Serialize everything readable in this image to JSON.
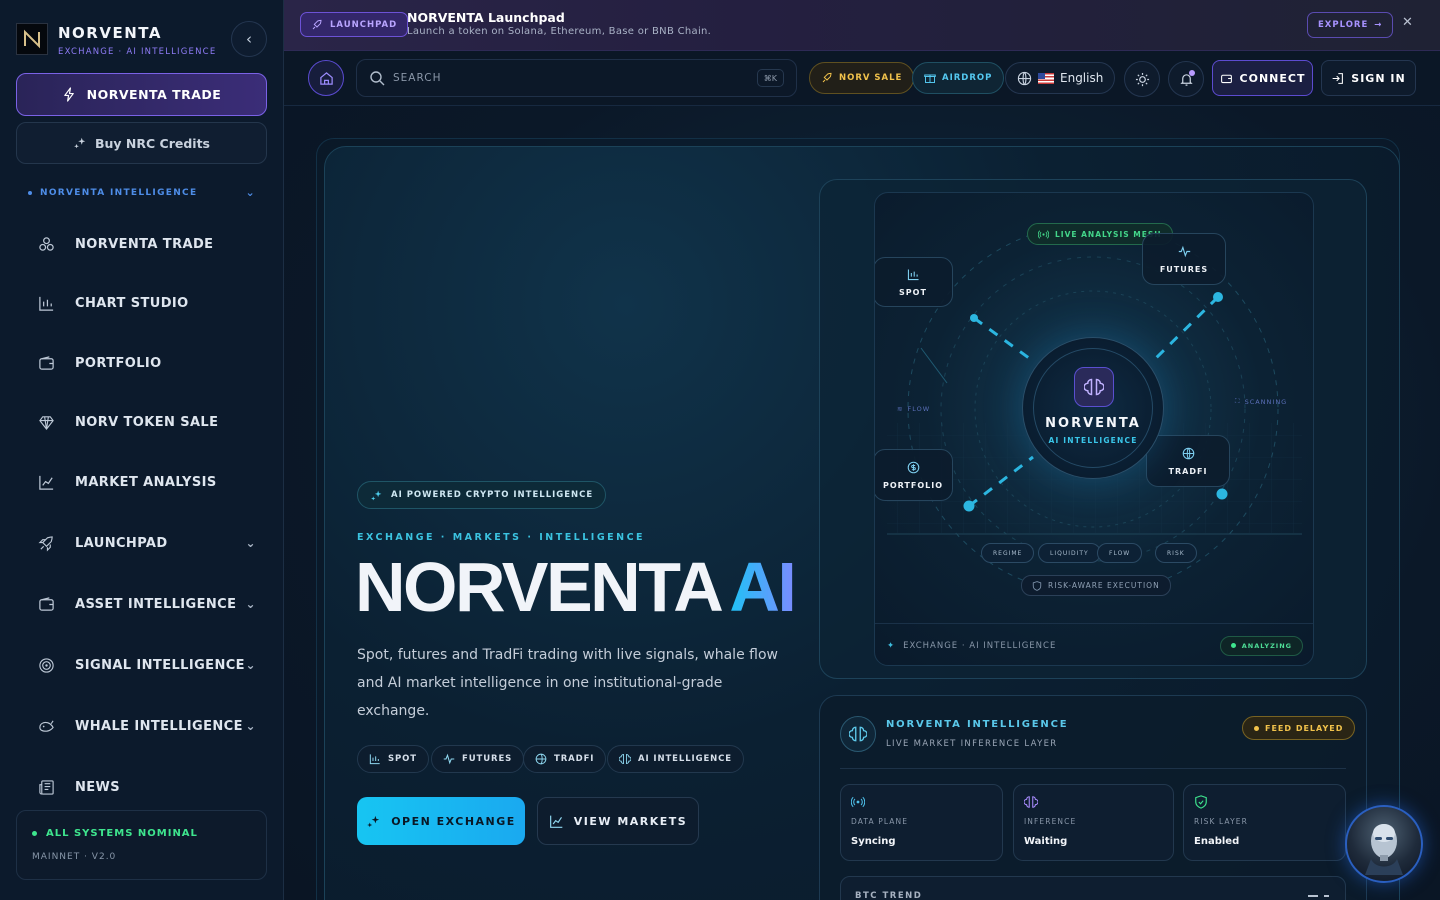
{
  "sidebar": {
    "brand": "NORVENTA",
    "brand_sub": "EXCHANGE · AI INTELLIGENCE",
    "primary_button": "NORVENTA TRADE",
    "credits_button": "Buy NRC Credits",
    "section_title": "NORVENTA INTELLIGENCE",
    "items": [
      {
        "label": "NORVENTA TRADE",
        "icon": "trade-nodes-icon",
        "expandable": false
      },
      {
        "label": "CHART STUDIO",
        "icon": "chart-studio-icon",
        "expandable": false
      },
      {
        "label": "PORTFOLIO",
        "icon": "wallet-icon",
        "expandable": false
      },
      {
        "label": "NORV TOKEN SALE",
        "icon": "diamond-icon",
        "expandable": false
      },
      {
        "label": "MARKET ANALYSIS",
        "icon": "line-chart-icon",
        "expandable": false
      },
      {
        "label": "LAUNCHPAD",
        "icon": "rocket-icon",
        "expandable": true
      },
      {
        "label": "ASSET INTELLIGENCE",
        "icon": "wallet-icon",
        "expandable": true
      },
      {
        "label": "SIGNAL INTELLIGENCE",
        "icon": "target-icon",
        "expandable": true
      },
      {
        "label": "WHALE INTELLIGENCE",
        "icon": "whale-icon",
        "expandable": true
      },
      {
        "label": "NEWS",
        "icon": "news-icon",
        "expandable": false
      }
    ],
    "status": {
      "label": "ALL SYSTEMS NOMINAL",
      "network": "MAINNET · V2.0"
    }
  },
  "banner": {
    "pill": "LAUNCHPAD",
    "title": "NORVENTA Launchpad",
    "subtitle": "Launch a token on Solana, Ethereum, Base or BNB Chain.",
    "explore": "EXPLORE"
  },
  "topbar": {
    "search_placeholder": "SEARCH",
    "search_shortcut": "⌘K",
    "norv_sale": "NORV SALE",
    "airdrop": "AIRDROP",
    "language": "English",
    "connect": "CONNECT",
    "sign_in": "SIGN IN"
  },
  "hero": {
    "badge": "AI POWERED CRYPTO INTELLIGENCE",
    "kicker": "EXCHANGE · MARKETS · INTELLIGENCE",
    "title_main": "NORVENTA",
    "title_accent": "AI",
    "description": "Spot, futures and TradFi trading with live signals, whale flow and AI market intelligence in one institutional-grade exchange.",
    "chips": [
      "SPOT",
      "FUTURES",
      "TRADFI",
      "AI INTELLIGENCE"
    ],
    "primary_cta": "OPEN EXCHANGE",
    "secondary_cta": "VIEW MARKETS"
  },
  "viz": {
    "live_pill": "LIVE ANALYSIS MESH",
    "core_name": "NORVENTA",
    "core_sub": "AI INTELLIGENCE",
    "nodes": {
      "spot": "SPOT",
      "futures": "FUTURES",
      "portfolio": "PORTFOLIO",
      "tradfi": "TRADFI"
    },
    "flow_label": "FLOW",
    "scanning_label": "SCANNING",
    "tags": [
      "REGIME",
      "LIQUIDITY",
      "FLOW",
      "RISK"
    ],
    "risk_pill": "RISK-AWARE EXECUTION",
    "footer": "EXCHANGE · AI INTELLIGENCE",
    "analyzing": "ANALYZING"
  },
  "intel": {
    "title": "NORVENTA INTELLIGENCE",
    "subtitle": "LIVE MARKET INFERENCE LAYER",
    "feed_status": "FEED DELAYED",
    "metrics": [
      {
        "label": "DATA PLANE",
        "value": "Syncing",
        "icon": "signal-icon",
        "color": "#4fc2ec"
      },
      {
        "label": "INFERENCE",
        "value": "Waiting",
        "icon": "brain-icon",
        "color": "#a98cff"
      },
      {
        "label": "RISK LAYER",
        "value": "Enabled",
        "icon": "shield-check-icon",
        "color": "#3ee58e"
      }
    ],
    "btc_trend": "BTC TREND"
  },
  "colors": {
    "accent": "#7a62e6",
    "cyan": "#1ec3f5",
    "green": "#3ee58e",
    "gold": "#f1c24b"
  }
}
